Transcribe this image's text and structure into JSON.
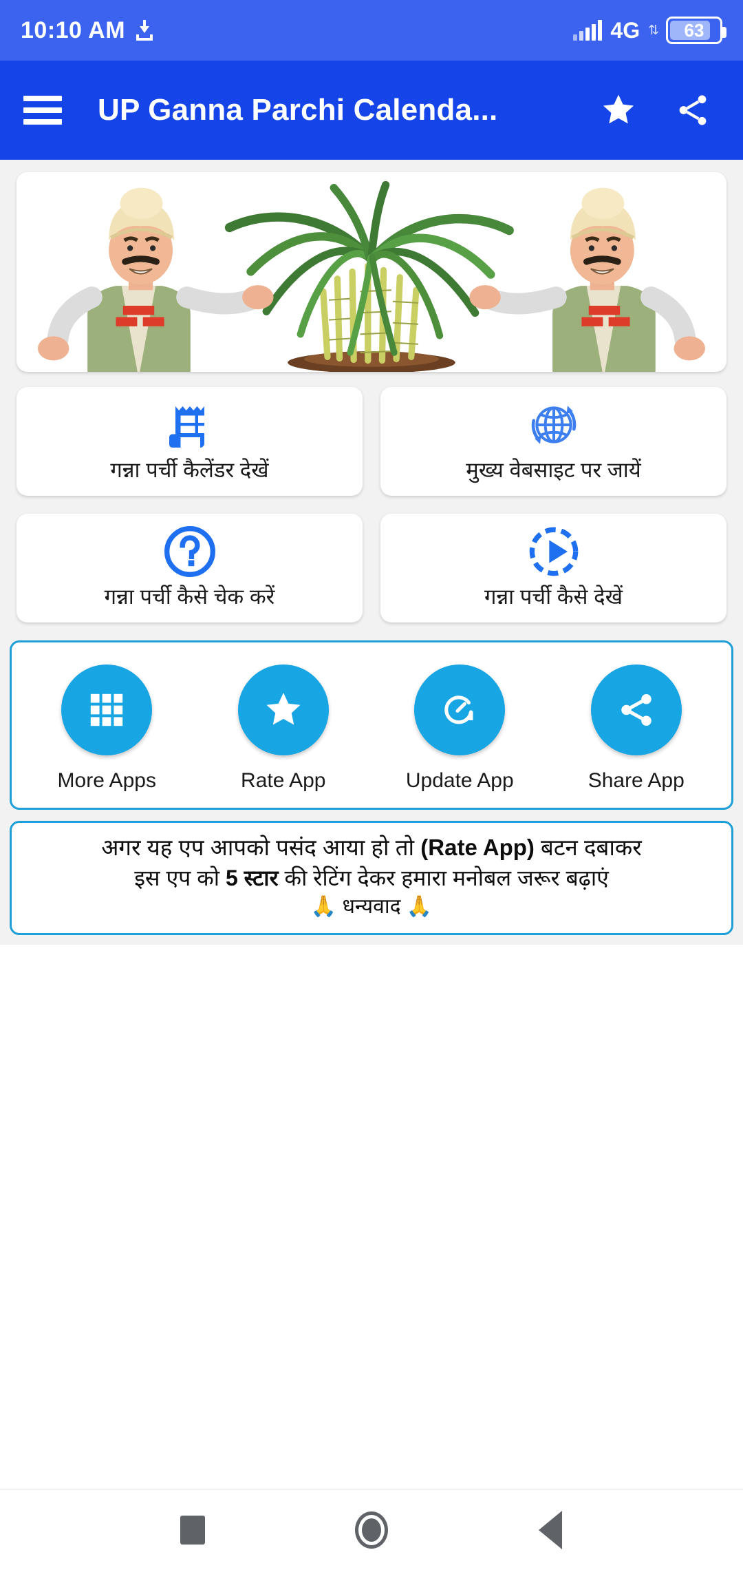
{
  "status_bar": {
    "time": "10:10 AM",
    "download_icon": "download-icon",
    "signal_icon": "signal-bars-icon",
    "network": "4G",
    "data_arrows": "⇅",
    "battery_level": "63"
  },
  "app_bar": {
    "menu_icon": "hamburger-menu-icon",
    "title": "UP Ganna Parchi Calenda...",
    "favorite_icon": "star-icon",
    "share_icon": "share-icon"
  },
  "hero": {
    "alt": "two-farmers-with-sugarcane-illustration"
  },
  "menu_cards": [
    {
      "icon": "receipt-slip-icon",
      "label": "गन्ना पर्ची कैलेंडर देखें"
    },
    {
      "icon": "globe-refresh-icon",
      "label": "मुख्य वेबसाइट पर जायें"
    },
    {
      "icon": "question-circle-icon",
      "label": "गन्ना पर्ची कैसे चेक करें"
    },
    {
      "icon": "play-dashed-circle-icon",
      "label": "गन्ना पर्ची कैसे देखें"
    }
  ],
  "actions": [
    {
      "icon": "apps-grid-icon",
      "label": "More Apps"
    },
    {
      "icon": "star-icon",
      "label": "Rate App"
    },
    {
      "icon": "update-refresh-icon",
      "label": "Update App"
    },
    {
      "icon": "share-icon",
      "label": "Share App"
    }
  ],
  "notice": {
    "line1_a": "अगर यह एप आपको पसंद आया हो तो ",
    "line1_bold": "(Rate App)",
    "line1_b": " बटन दबाकर",
    "line2_a": "इस एप को ",
    "line2_bold": " 5 स्टार ",
    "line2_b": " की रेटिंग देकर हमारा मनोबल जरूर बढ़ाएं",
    "line3": "🙏 धन्यवाद 🙏"
  },
  "nav_bar": {
    "recents": "recents-square-icon",
    "home": "home-circle-icon",
    "back": "back-triangle-icon"
  },
  "colors": {
    "status_bar": "#3b63f0",
    "app_bar": "#1544e8",
    "accent_cyan": "#17a5e3",
    "menu_icon_blue": "#1f70f0",
    "border_blue": "#1e9fd8",
    "page_bg": "#f2f2f2"
  }
}
